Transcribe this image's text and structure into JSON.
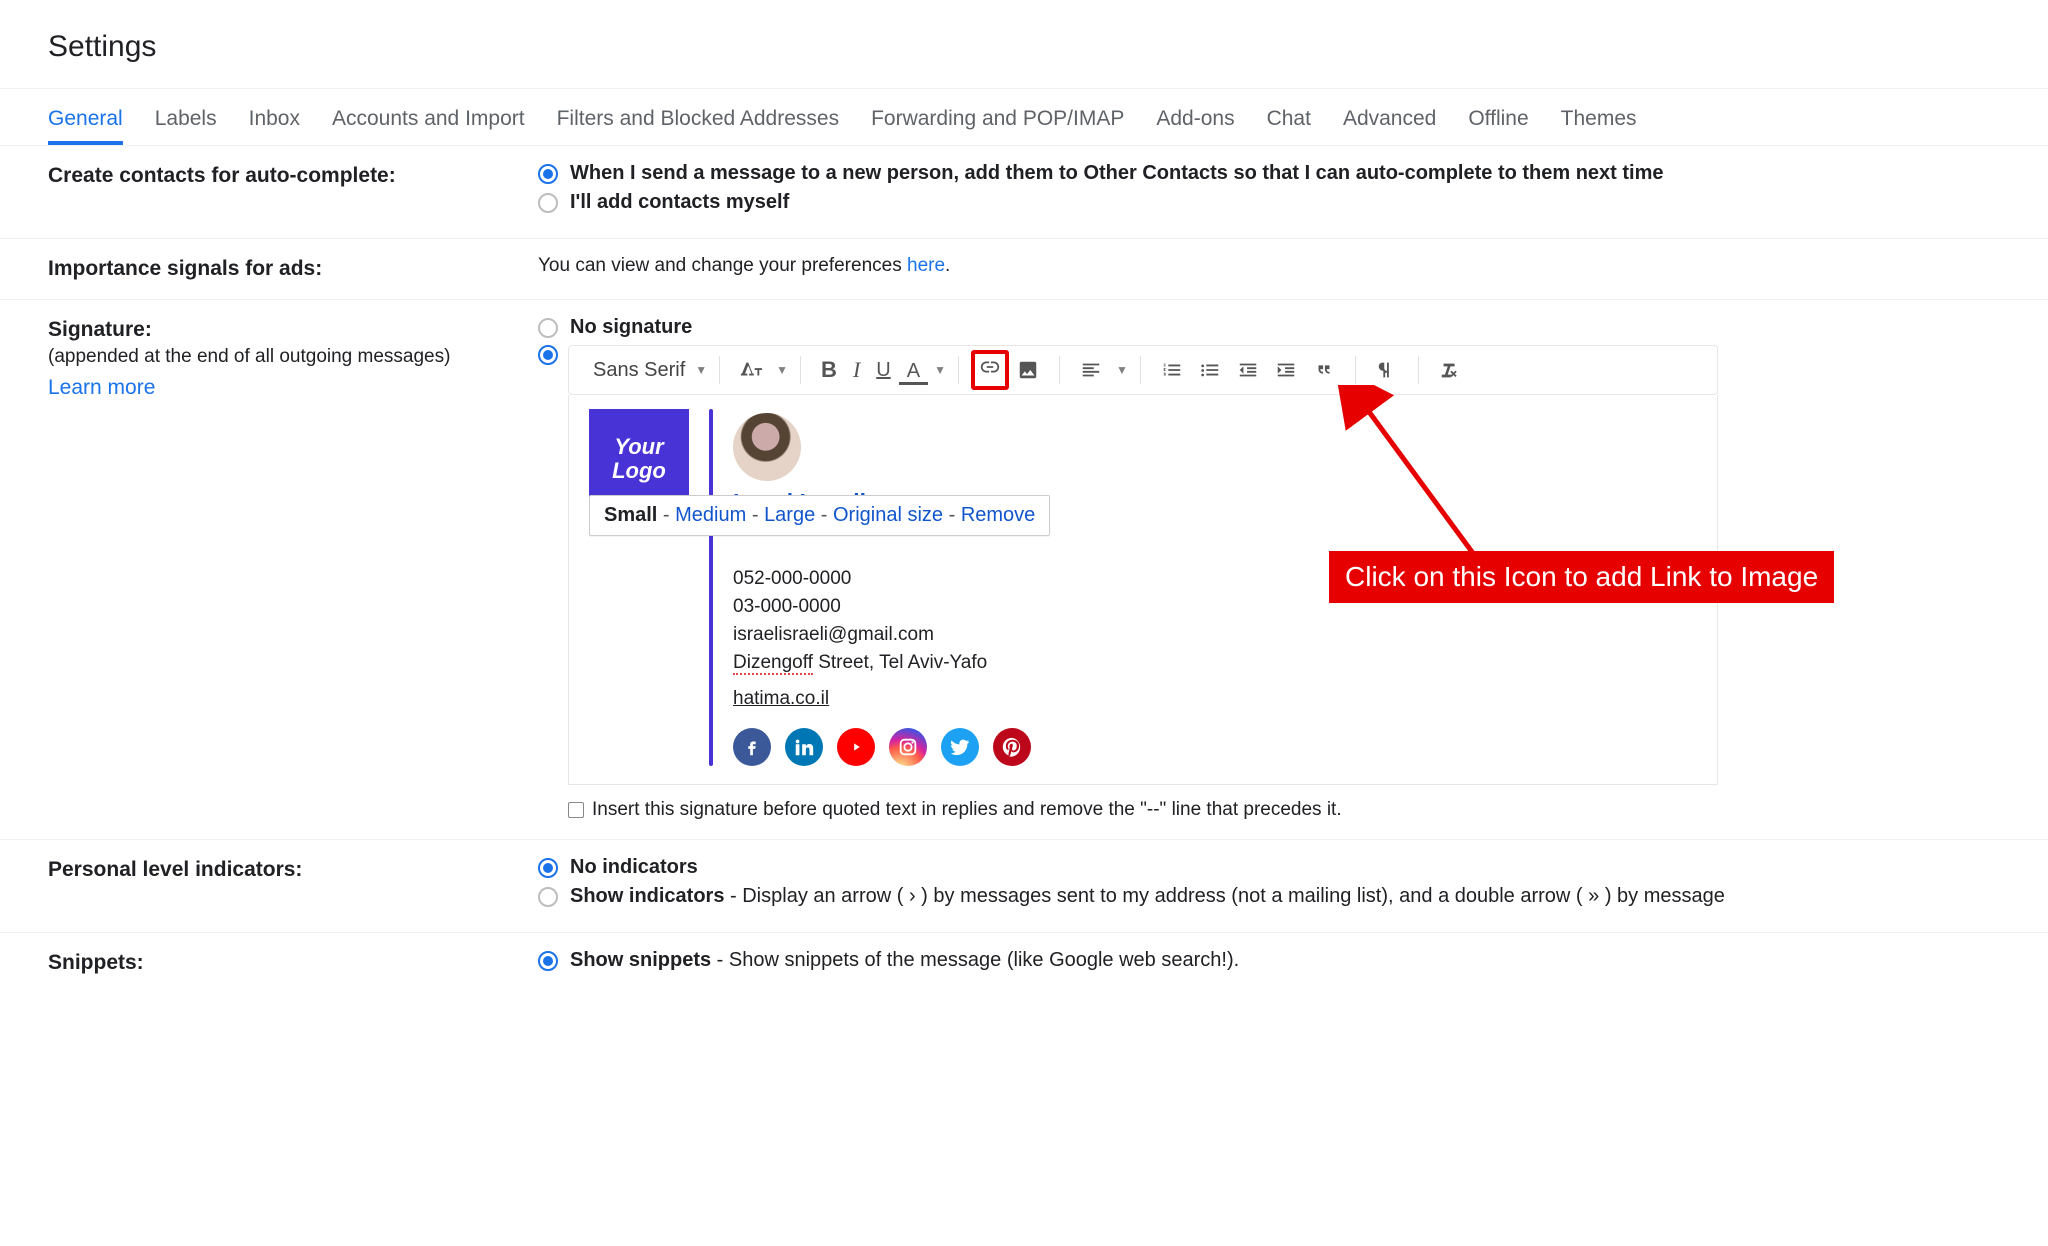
{
  "title": "Settings",
  "tabs": [
    "General",
    "Labels",
    "Inbox",
    "Accounts and Import",
    "Filters and Blocked Addresses",
    "Forwarding and POP/IMAP",
    "Add-ons",
    "Chat",
    "Advanced",
    "Offline",
    "Themes"
  ],
  "auto_complete": {
    "label": "Create contacts for auto-complete:",
    "opt1": "When I send a message to a new person, add them to Other Contacts so that I can auto-complete to them next time",
    "opt2": "I'll add contacts myself"
  },
  "ads": {
    "label": "Importance signals for ads:",
    "text_pre": "You can view and change your preferences ",
    "link": "here",
    "text_post": "."
  },
  "signature": {
    "label": "Signature:",
    "sub": "(appended at the end of all outgoing messages)",
    "learn_more": "Learn more",
    "no_signature": "No signature",
    "font": "Sans Serif",
    "image_menu": {
      "small": "Small",
      "medium": "Medium",
      "large": "Large",
      "original": "Original size",
      "remove": "Remove"
    },
    "logo_line1": "Your",
    "logo_line2": "Logo",
    "name": "Israel Israeli",
    "phone1": "052-000-0000",
    "phone2": "03-000-0000",
    "email": "israelisraeli@gmail.com",
    "street_word": "Dizengoff",
    "address_rest": " Street, Tel Aviv-Yafo",
    "site": "hatima.co.il",
    "insert_before": "Insert this signature before quoted text in replies and remove the \"--\" line that precedes it."
  },
  "callout": "Click on this Icon to add Link to Image",
  "indicators": {
    "label": "Personal level indicators:",
    "opt1": "No indicators",
    "opt2_bold": "Show indicators",
    "opt2_rest": " - Display an arrow ( › ) by messages sent to my address (not a mailing list), and a double arrow ( » ) by message"
  },
  "snippets": {
    "label": "Snippets:",
    "opt1_bold": "Show snippets",
    "opt1_rest": " - Show snippets of the message (like Google web search!)."
  }
}
